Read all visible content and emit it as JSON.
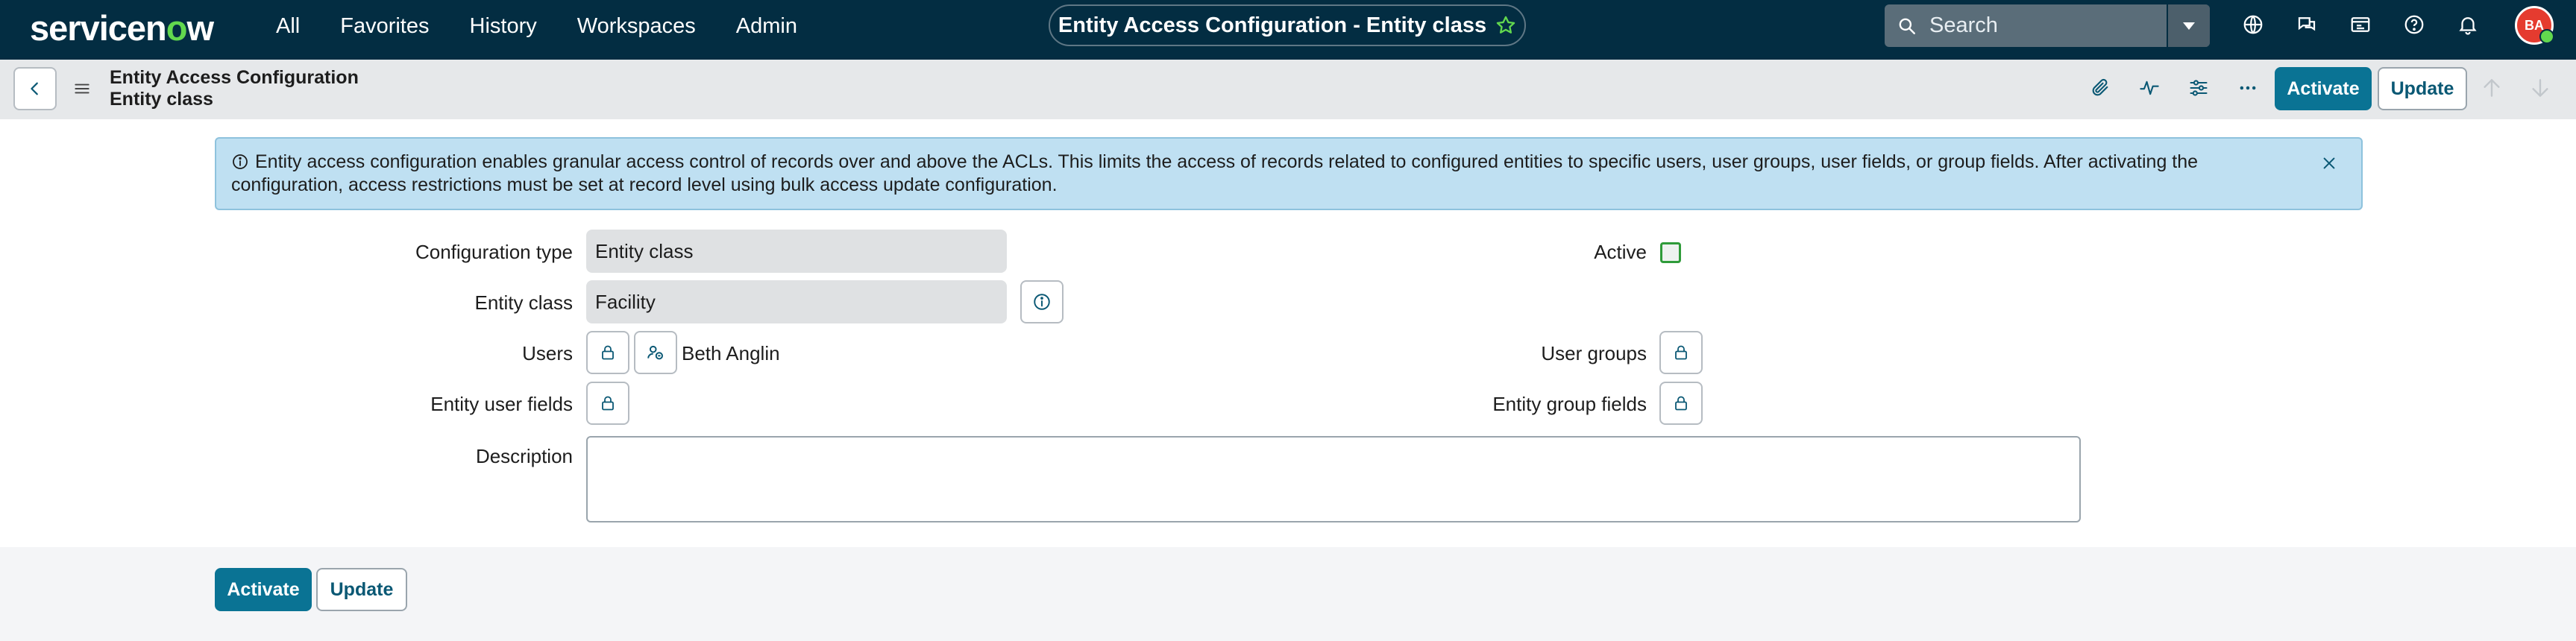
{
  "brand": {
    "logo_part1": "servicen",
    "logo_o": "o",
    "logo_part2": "w"
  },
  "nav": {
    "menu": [
      "All",
      "Favorites",
      "History",
      "Workspaces",
      "Admin"
    ],
    "context_title": "Entity Access Configuration - Entity class",
    "search_placeholder": "Search",
    "icons": [
      "globe-icon",
      "chat-icon",
      "scripts-icon",
      "help-icon",
      "bell-icon"
    ],
    "avatar_initials": "BA"
  },
  "form_header": {
    "title_line1": "Entity Access Configuration",
    "title_line2": "Entity class",
    "tools": [
      "paperclip-icon",
      "activity-icon",
      "settings-sliders-icon",
      "more-icon"
    ],
    "activate_label": "Activate",
    "update_label": "Update"
  },
  "banner": {
    "text": "Entity access configuration enables granular access control of records over and above the ACLs. This limits the access of records related to configured entities to specific users, user groups, user fields, or group fields. After activating the configuration, access restrictions must be set at record level using bulk access update configuration."
  },
  "form": {
    "configuration_type_label": "Configuration type",
    "configuration_type_value": "Entity class",
    "entity_class_label": "Entity class",
    "entity_class_value": "Facility",
    "users_label": "Users",
    "users_value": "Beth Anglin",
    "entity_user_fields_label": "Entity user fields",
    "description_label": "Description",
    "description_value": "",
    "active_label": "Active",
    "active_checked": false,
    "user_groups_label": "User groups",
    "entity_group_fields_label": "Entity group fields"
  },
  "footer": {
    "activate_label": "Activate",
    "update_label": "Update"
  },
  "colors": {
    "nav_bg": "#032d42",
    "primary": "#0a7394",
    "banner_bg": "#bfe0f2",
    "logo_accent": "#62d84e"
  }
}
